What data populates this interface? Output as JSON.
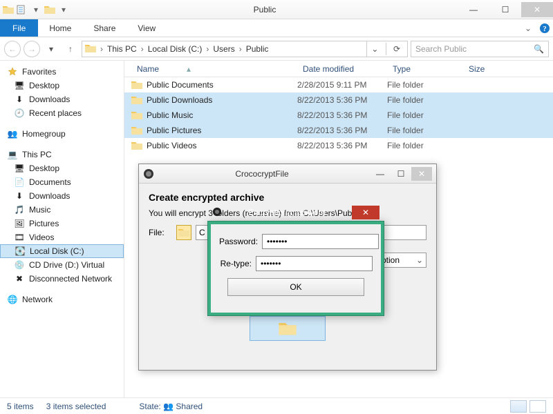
{
  "window": {
    "title": "Public",
    "tabs": {
      "file": "File",
      "home": "Home",
      "share": "Share",
      "view": "View"
    }
  },
  "breadcrumb": [
    "This PC",
    "Local Disk (C:)",
    "Users",
    "Public"
  ],
  "search": {
    "placeholder": "Search Public"
  },
  "sidebar": {
    "favorites": {
      "label": "Favorites",
      "items": [
        "Desktop",
        "Downloads",
        "Recent places"
      ]
    },
    "homegroup": "Homegroup",
    "thispc": {
      "label": "This PC",
      "items": [
        "Desktop",
        "Documents",
        "Downloads",
        "Music",
        "Pictures",
        "Videos",
        "Local Disk (C:)",
        "CD Drive (D:) Virtual",
        "Disconnected Network"
      ]
    },
    "network": "Network"
  },
  "columns": {
    "name": "Name",
    "date": "Date modified",
    "type": "Type",
    "size": "Size"
  },
  "files": [
    {
      "name": "Public Documents",
      "date": "2/28/2015 9:11 PM",
      "type": "File folder",
      "selected": false
    },
    {
      "name": "Public Downloads",
      "date": "8/22/2013 5:36 PM",
      "type": "File folder",
      "selected": true
    },
    {
      "name": "Public Music",
      "date": "8/22/2013 5:36 PM",
      "type": "File folder",
      "selected": true
    },
    {
      "name": "Public Pictures",
      "date": "8/22/2013 5:36 PM",
      "type": "File folder",
      "selected": true
    },
    {
      "name": "Public Videos",
      "date": "8/22/2013 5:36 PM",
      "type": "File folder",
      "selected": false
    }
  ],
  "statusbar": {
    "count": "5 items",
    "selected": "3 items selected",
    "state_label": "State:",
    "state_value": "Shared"
  },
  "croco": {
    "title": "CrococryptFile",
    "heading": "Create encrypted archive",
    "desc": "You will encrypt 3 folders (recursive) from C:\\Users\\Public to:",
    "file_label": "File:",
    "file_value": "C",
    "crypto_label": "cryption",
    "pw": {
      "title": "Encryption password",
      "password_label": "Password:",
      "retype_label": "Re-type:",
      "password_value": "•••••••",
      "retype_value": "•••••••",
      "ok": "OK"
    }
  }
}
